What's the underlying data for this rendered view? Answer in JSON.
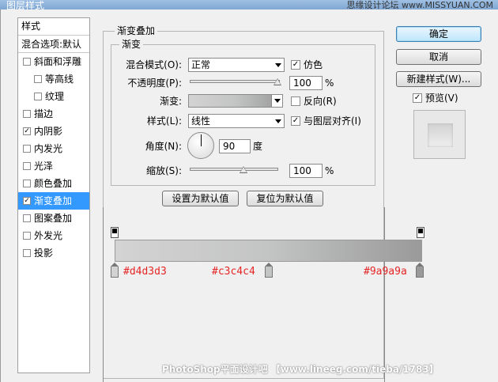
{
  "window": {
    "title": "图层样式",
    "watermark_top": "思缘设计论坛 www.MISSYUAN.COM"
  },
  "styles_list": {
    "header": "样式",
    "blend_row": "混合选项:默认",
    "items": [
      {
        "label": "斜面和浮雕",
        "checked": false,
        "indent": false
      },
      {
        "label": "等高线",
        "checked": false,
        "indent": true
      },
      {
        "label": "纹理",
        "checked": false,
        "indent": true
      },
      {
        "label": "描边",
        "checked": false,
        "indent": false
      },
      {
        "label": "内阴影",
        "checked": true,
        "indent": false
      },
      {
        "label": "内发光",
        "checked": false,
        "indent": false
      },
      {
        "label": "光泽",
        "checked": false,
        "indent": false
      },
      {
        "label": "颜色叠加",
        "checked": false,
        "indent": false
      },
      {
        "label": "渐变叠加",
        "checked": true,
        "indent": false,
        "selected": true
      },
      {
        "label": "图案叠加",
        "checked": false,
        "indent": false
      },
      {
        "label": "外发光",
        "checked": false,
        "indent": false
      },
      {
        "label": "投影",
        "checked": false,
        "indent": false
      }
    ]
  },
  "panel": {
    "group_title": "渐变叠加",
    "subgroup_title": "渐变",
    "blend_mode_label": "混合模式(O):",
    "blend_mode_value": "正常",
    "dither_label": "仿色",
    "dither_checked": true,
    "opacity_label": "不透明度(P):",
    "opacity_value": "100",
    "opacity_unit": "%",
    "gradient_label": "渐变:",
    "reverse_label": "反向(R)",
    "reverse_checked": false,
    "style_label": "样式(L):",
    "style_value": "线性",
    "align_label": "与图层对齐(I)",
    "align_checked": true,
    "angle_label": "角度(N):",
    "angle_value": "90",
    "angle_unit": "度",
    "scale_label": "缩放(S):",
    "scale_value": "100",
    "scale_unit": "%",
    "set_default_button": "设置为默认值",
    "reset_default_button": "复位为默认值"
  },
  "buttons": {
    "ok": "确定",
    "cancel": "取消",
    "new_style": "新建样式(W)...",
    "preview_label": "预览(V)",
    "preview_checked": true
  },
  "gradient_editor": {
    "stops": [
      {
        "color": "#d4d3d3",
        "location": 0
      },
      {
        "color": "#c3c4c4",
        "location": 50
      },
      {
        "color": "#9a9a9a",
        "location": 100
      }
    ],
    "annotations": [
      "#d4d3d3",
      "#c3c4c4",
      "#9a9a9a"
    ]
  },
  "footer_watermark": "PhotoShop平面设计吧 【www.lineeg.com/tieba/1783】"
}
